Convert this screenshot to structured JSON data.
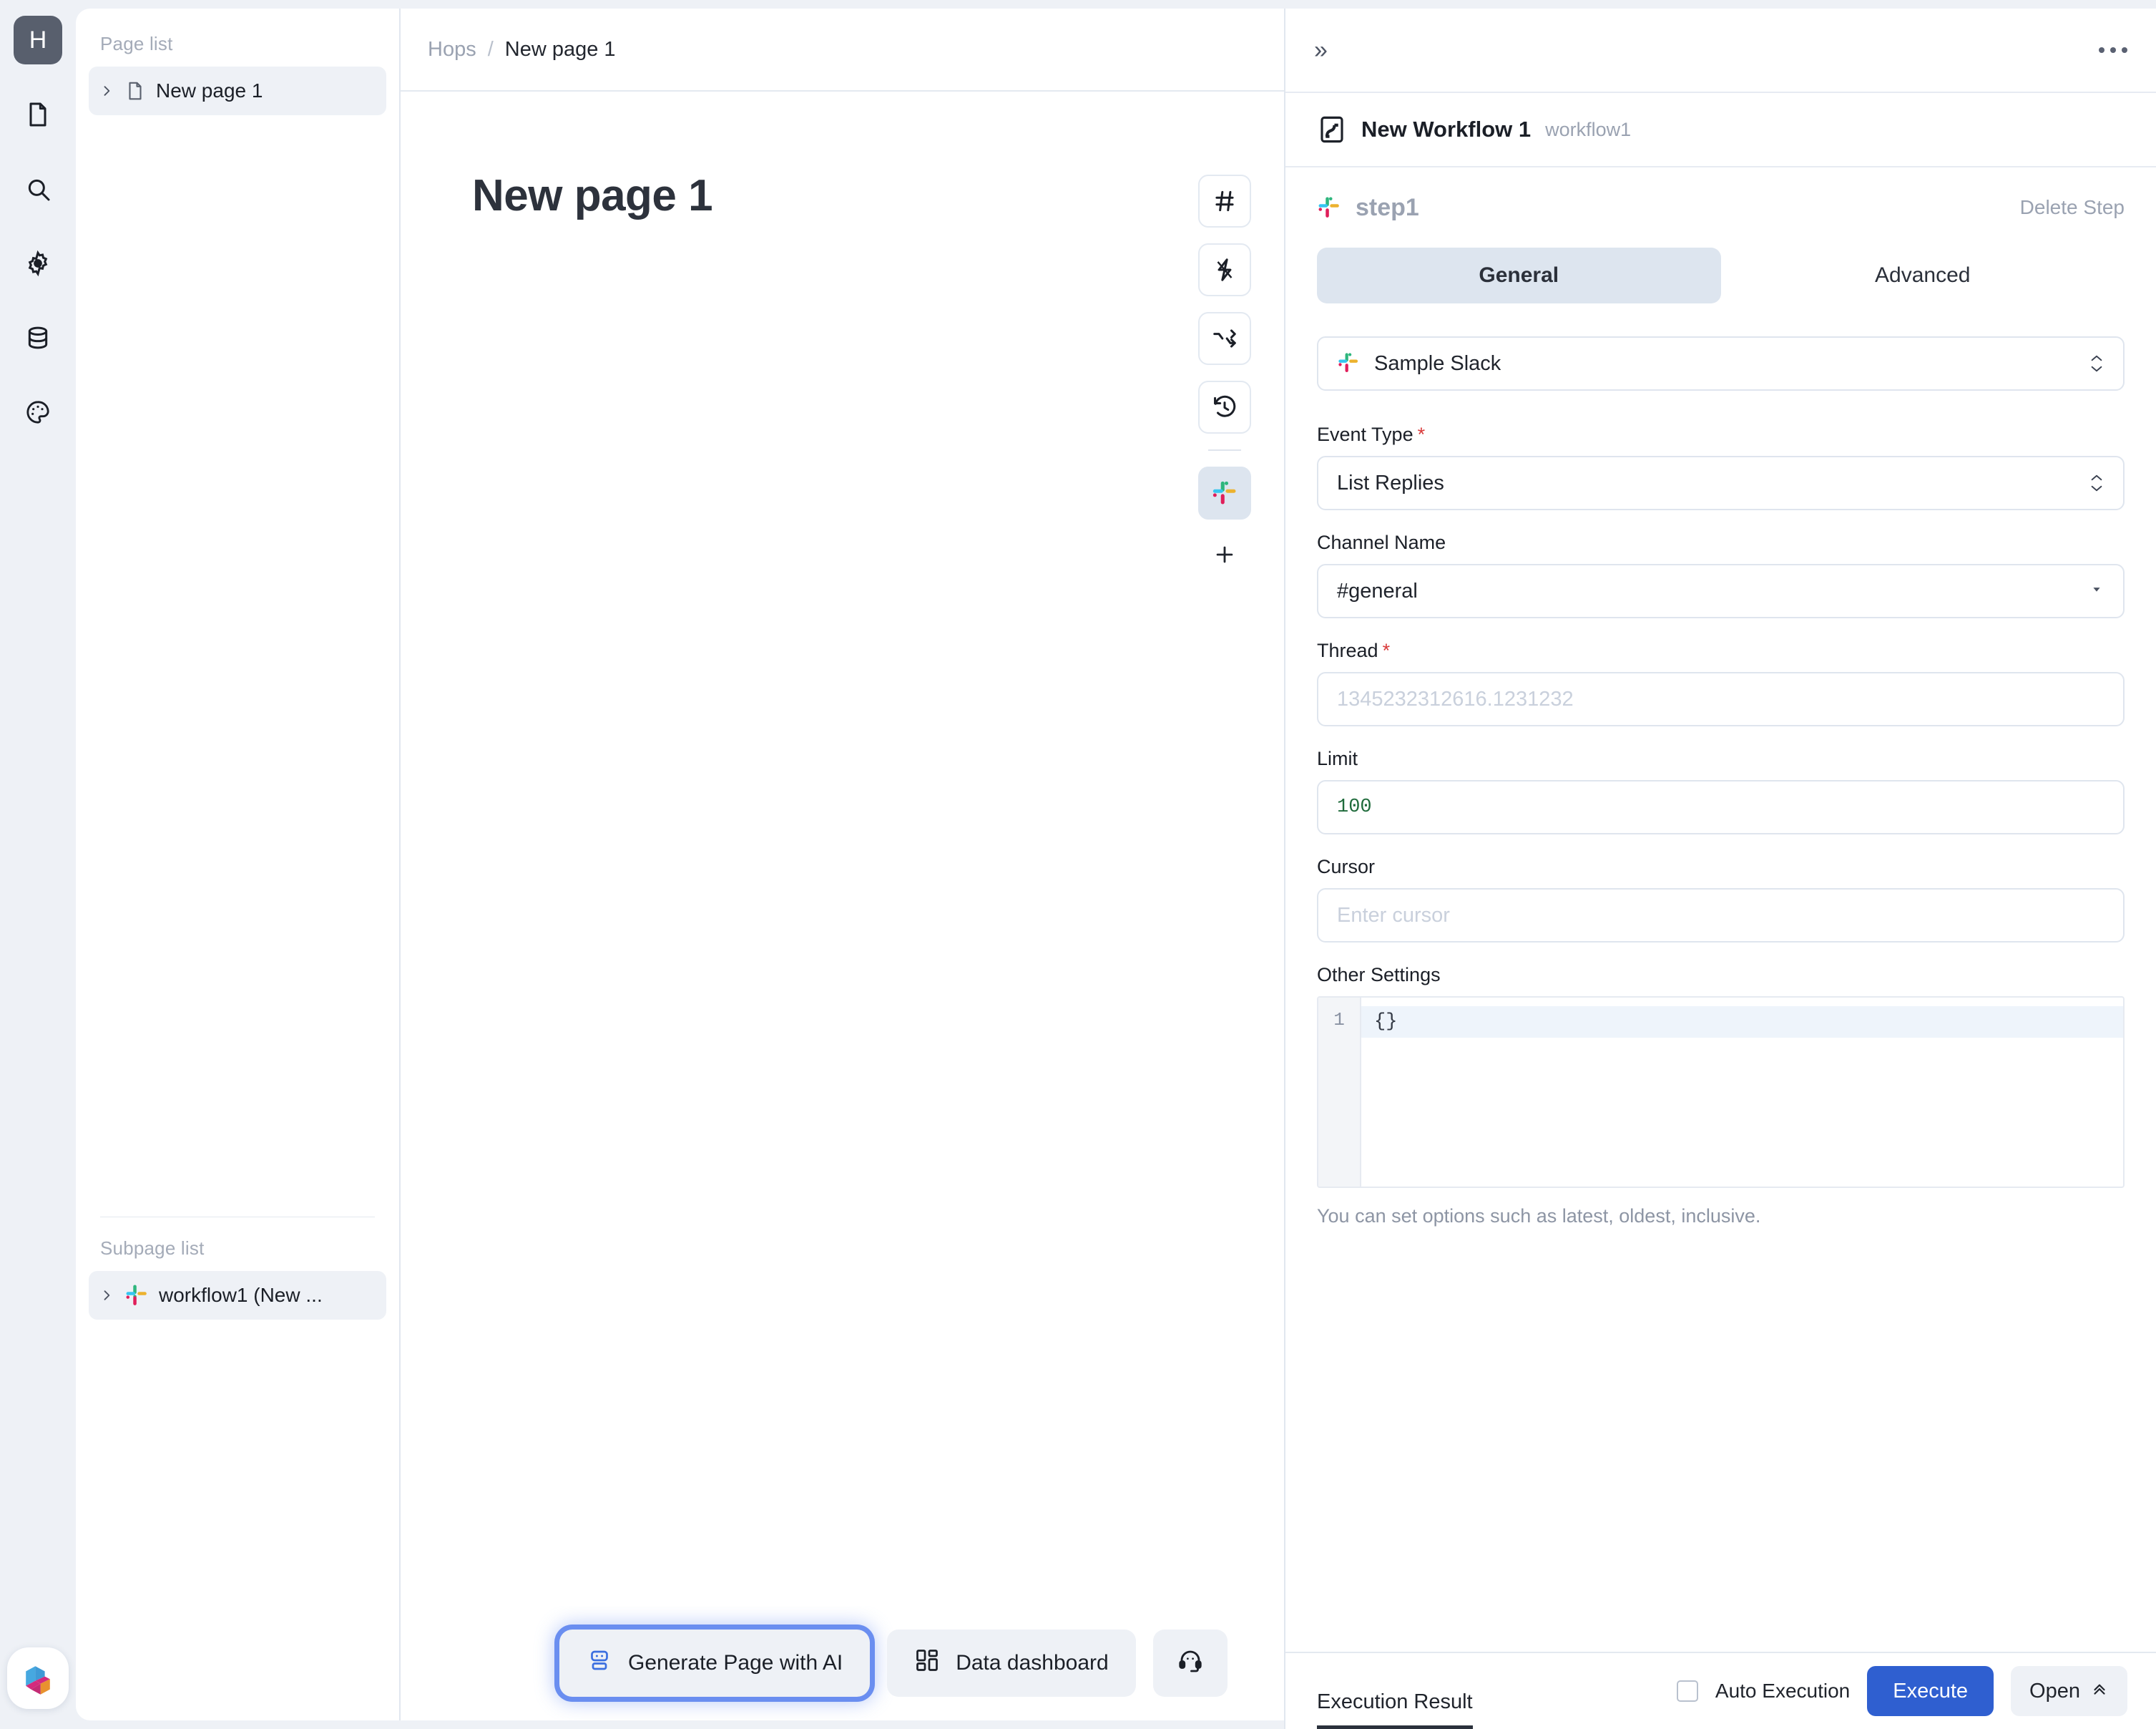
{
  "rail": {
    "avatar_initial": "H",
    "icons": [
      "document-icon",
      "search-icon",
      "gear-icon",
      "database-icon",
      "palette-icon"
    ],
    "logo": "app-logo"
  },
  "pagelist": {
    "heading": "Page list",
    "items": [
      {
        "label": "New page 1",
        "icon": "document-icon",
        "expanded": false
      }
    ],
    "subpage_heading": "Subpage list",
    "subpages": [
      {
        "label": "workflow1 (New ...",
        "icon": "slack-icon",
        "expanded": false
      }
    ]
  },
  "canvas": {
    "breadcrumb": {
      "root": "Hops",
      "separator": "/",
      "current": "New page 1"
    },
    "page_title": "New page 1",
    "vtoolbar": [
      {
        "icon": "hash-icon",
        "active": false
      },
      {
        "icon": "lightning-icon",
        "active": false
      },
      {
        "icon": "shuffle-arrows-icon",
        "active": false
      },
      {
        "icon": "history-clock-icon",
        "active": false
      },
      {
        "icon": "slack-icon",
        "active": true
      }
    ],
    "vtoolbar_add": "plus-icon",
    "bottom_buttons": [
      {
        "label": "Generate Page with AI",
        "icon": "robot-icon",
        "highlighted": true
      },
      {
        "label": "Data dashboard",
        "icon": "dashboard-grid-icon",
        "highlighted": false
      },
      {
        "label": "",
        "icon": "headset-support-icon",
        "highlighted": false
      }
    ]
  },
  "right_panel": {
    "collapse_icon": "chevron-double-right-icon",
    "more_icon": "ellipsis-icon",
    "workflow": {
      "icon": "workflow-icon",
      "name": "New Workflow 1",
      "slug": "workflow1"
    },
    "step": {
      "icon": "slack-icon",
      "name": "step1",
      "delete_label": "Delete Step"
    },
    "tabs": [
      {
        "label": "General",
        "active": true
      },
      {
        "label": "Advanced",
        "active": false
      }
    ],
    "connection": {
      "icon": "slack-icon",
      "value": "Sample Slack",
      "control": "stepper-select"
    },
    "fields": [
      {
        "label": "Event Type",
        "required": true,
        "control": "stepper-select",
        "value": "List Replies",
        "placeholder": ""
      },
      {
        "label": "Channel Name",
        "required": false,
        "control": "dropdown",
        "value": "#general",
        "placeholder": ""
      },
      {
        "label": "Thread",
        "required": true,
        "control": "text",
        "value": "",
        "placeholder": "1345232312616.1231232"
      },
      {
        "label": "Limit",
        "required": false,
        "control": "number",
        "value": "100",
        "placeholder": ""
      },
      {
        "label": "Cursor",
        "required": false,
        "control": "text",
        "value": "",
        "placeholder": "Enter cursor"
      }
    ],
    "other_settings": {
      "label": "Other Settings",
      "line_number": "1",
      "code": "{}",
      "hint": "You can set options such as latest, oldest, inclusive."
    },
    "footer": {
      "result_tab": "Execution Result",
      "auto_execution_label": "Auto Execution",
      "auto_execution_checked": false,
      "execute_label": "Execute",
      "open_label": "Open",
      "open_icon": "chevron-double-up-icon"
    }
  },
  "colors": {
    "accent_blue": "#2f5fd0",
    "highlight_ring": "#6a8ef0",
    "panel_bg": "#ffffff",
    "app_bg": "#eef1f6",
    "required_red": "#d93b3b",
    "code_green": "#1f6b3b"
  }
}
